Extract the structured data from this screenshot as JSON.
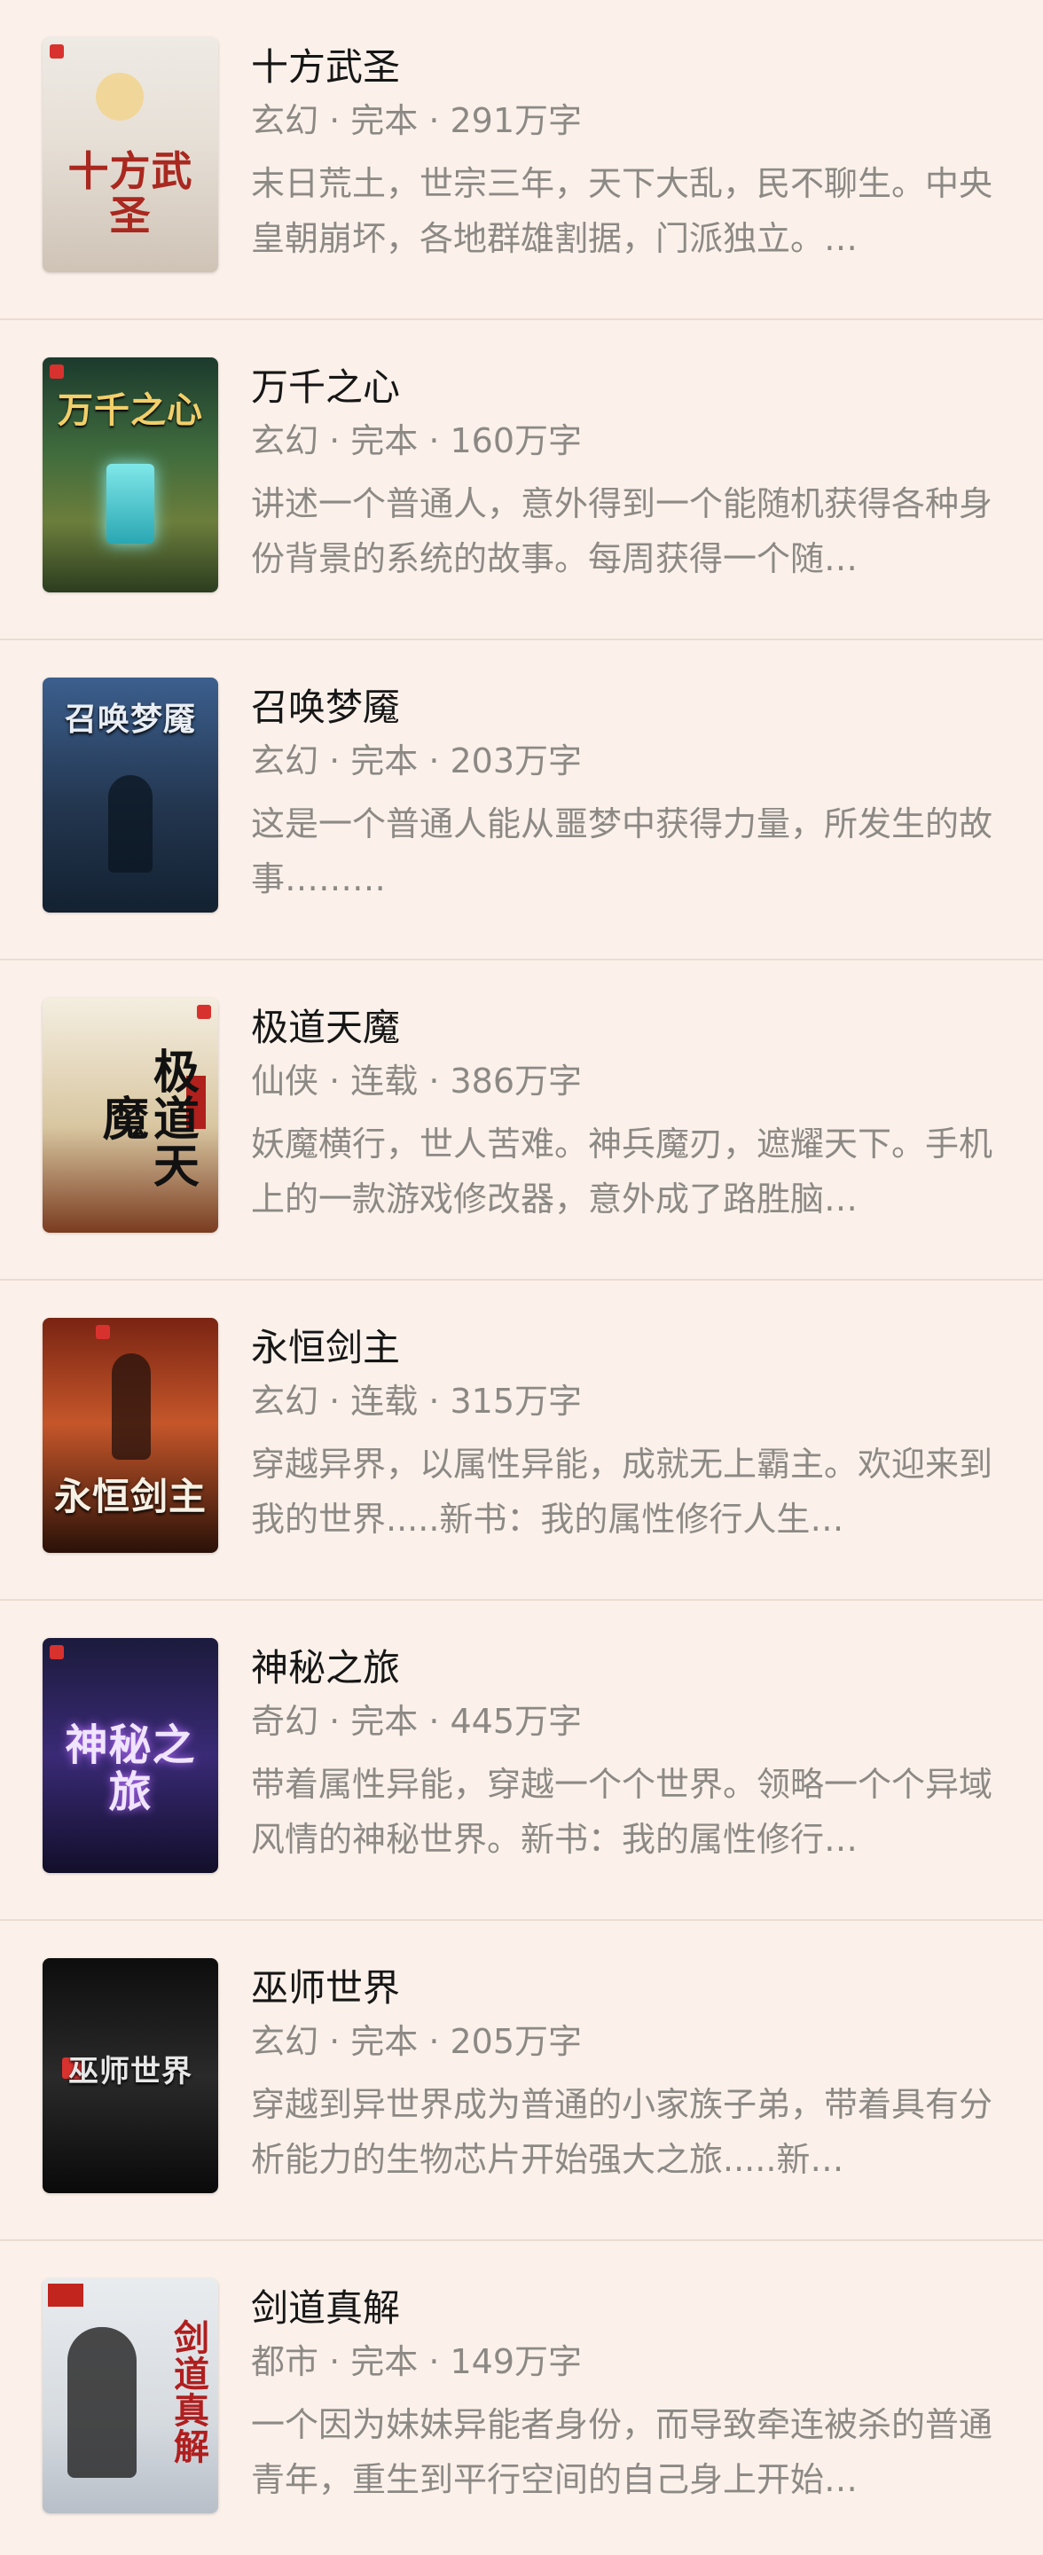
{
  "books": [
    {
      "title": "十方武圣",
      "meta": "玄幻 · 完本 · 291万字",
      "description": "末日荒土，世宗三年，天下大乱，民不聊生。中央皇朝崩坏，各地群雄割据，门派独立。…",
      "cover_text": "十方武圣",
      "cover_icon": "sun-cover-icon"
    },
    {
      "title": "万千之心",
      "meta": "玄幻 · 完本 · 160万字",
      "description": "讲述一个普通人，意外得到一个能随机获得各种身份背景的系统的故事。每周获得一个随…",
      "cover_text": "万千之心",
      "cover_icon": "portal-cover-icon"
    },
    {
      "title": "召唤梦魇",
      "meta": "玄幻 · 完本 · 203万字",
      "description": "这是一个普通人能从噩梦中获得力量，所发生的故事………",
      "cover_text": "召唤梦魇",
      "cover_icon": "figure-cover-icon"
    },
    {
      "title": "极道天魔",
      "meta": "仙侠 · 连载 · 386万字",
      "description": "妖魔横行，世人苦难。神兵魔刃，遮耀天下。手机上的一款游戏修改器，意外成了路胜脑…",
      "cover_text": "极道天魔",
      "cover_icon": "stamp-cover-icon"
    },
    {
      "title": "永恒剑主",
      "meta": "玄幻 · 连载 · 315万字",
      "description": "穿越异界，以属性异能，成就无上霸主。欢迎来到我的世界.....新书：我的属性修行人生…",
      "cover_text": "永恒剑主",
      "cover_icon": "figure-cover-icon"
    },
    {
      "title": "神秘之旅",
      "meta": "奇幻 · 完本 · 445万字",
      "description": "带着属性异能，穿越一个个世界。领略一个个异域风情的神秘世界。新书：我的属性修行…",
      "cover_text": "神秘之旅",
      "cover_icon": "glow-cover-icon"
    },
    {
      "title": "巫师世界",
      "meta": "玄幻 · 完本 · 205万字",
      "description": "穿越到异世界成为普通的小家族子弟，带着具有分析能力的生物芯片开始强大之旅.....新…",
      "cover_text": "巫师世界",
      "cover_icon": "logo-cover-icon"
    },
    {
      "title": "剑道真解",
      "meta": "都市 · 完本 · 149万字",
      "description": "一个因为妹妹异能者身份，而导致牵连被杀的普通青年，重生到平行空间的自己身上开始…",
      "cover_text": "剑道真解",
      "cover_icon": "figure-cover-icon"
    }
  ],
  "colors": {
    "background": "#fbf1ea",
    "divider": "#ecdcd1",
    "title_text": "#161616",
    "secondary_text": "#8c8985"
  }
}
